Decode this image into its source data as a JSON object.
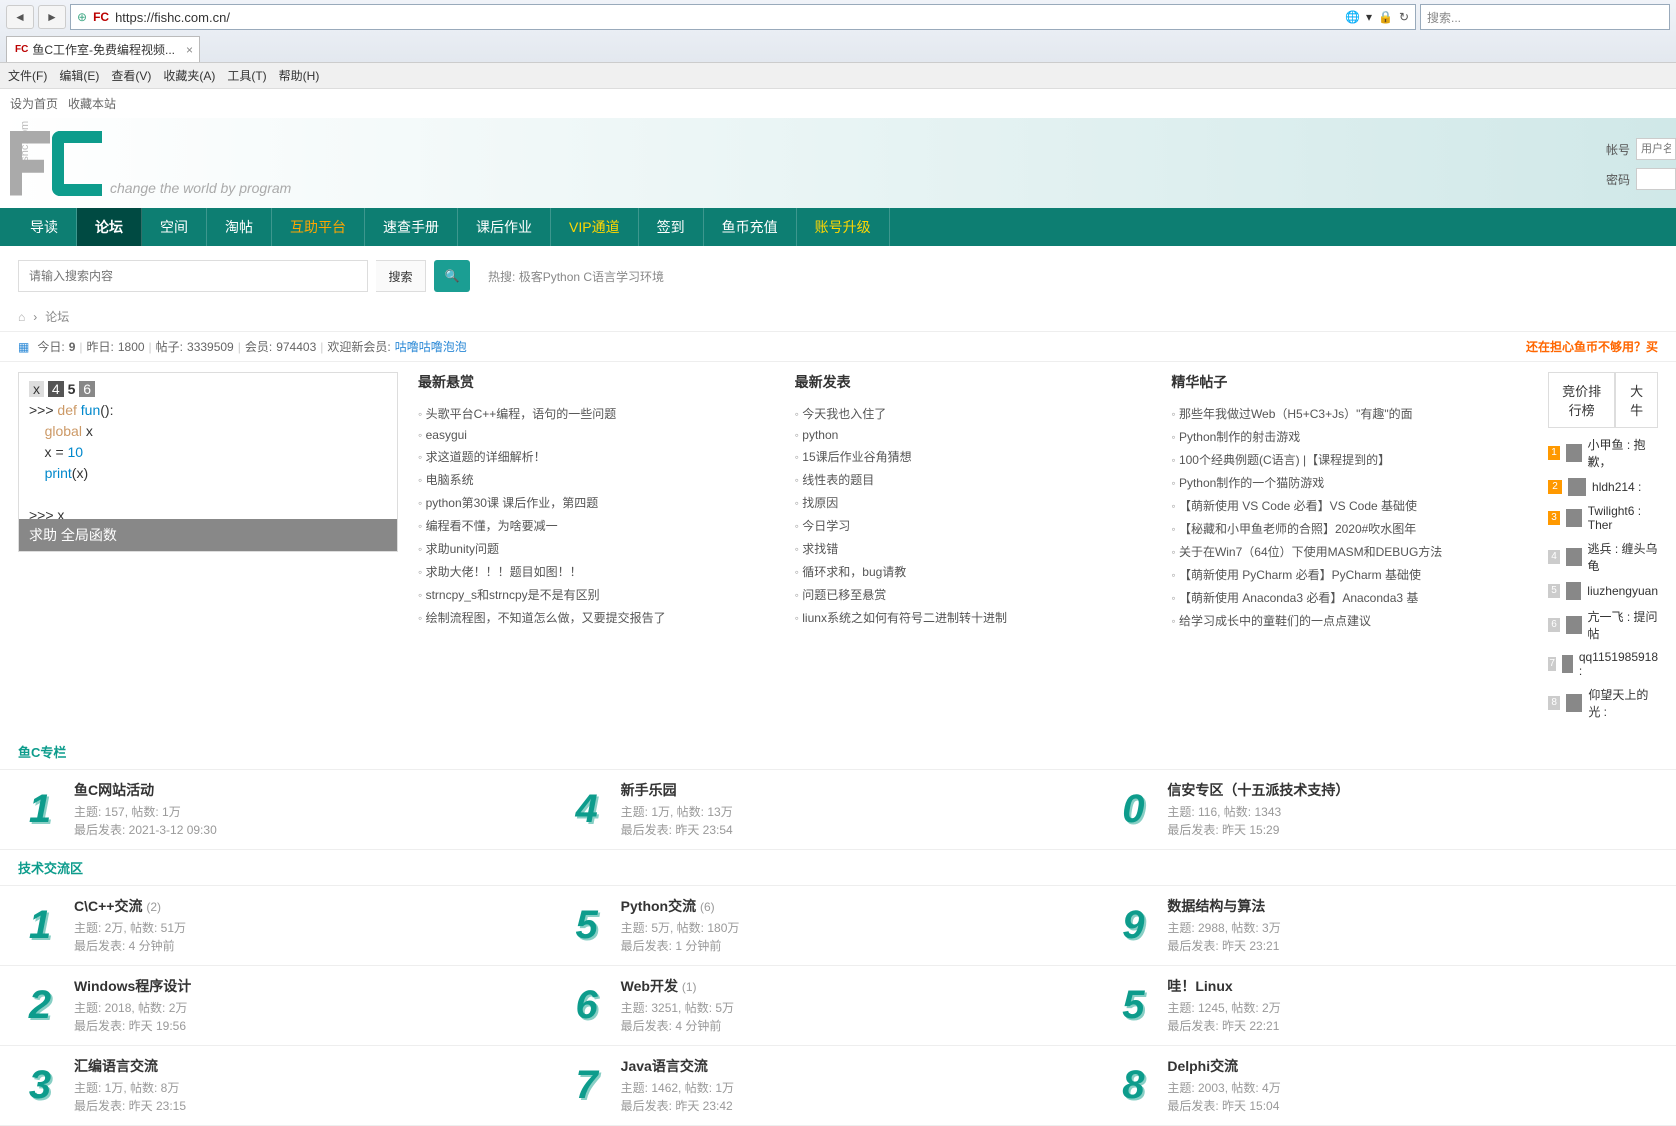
{
  "browser": {
    "url": "https://fishc.com.cn/",
    "search_placeholder": "搜索...",
    "tab_title": "鱼C工作室-免费编程视频...",
    "menus": [
      "文件(F)",
      "编辑(E)",
      "查看(V)",
      "收藏夹(A)",
      "工具(T)",
      "帮助(H)"
    ],
    "sub_links": [
      "设为首页",
      "收藏本站"
    ]
  },
  "logo_tagline": "change the world by program",
  "logo_side": "fishc.com",
  "login": {
    "user_label": "帐号",
    "user_placeholder": "用户名/Email",
    "pass_label": "密码"
  },
  "nav": [
    "导读",
    "论坛",
    "空间",
    "淘帖",
    "互助平台",
    "速查手册",
    "课后作业",
    "VIP通道",
    "签到",
    "鱼币充值",
    "账号升级"
  ],
  "search": {
    "placeholder": "请输入搜索内容",
    "select": "搜索",
    "hot_label": "热搜:",
    "hot_words": "极客Python  C语言学习环境"
  },
  "breadcrumb": "论坛",
  "stats": {
    "today_label": "今日:",
    "today": "9",
    "yesterday_label": "昨日:",
    "yesterday": "1800",
    "posts_label": "帖子:",
    "posts": "3339509",
    "members_label": "会员:",
    "members": "974403",
    "welcome_label": "欢迎新会员:",
    "welcome_name": "咕噜咕噜泡泡",
    "right_text": "还在担心鱼币不够用？买"
  },
  "code_box": {
    "footer": "求助 全局函数"
  },
  "col_titles": {
    "bounty": "最新悬赏",
    "latest": "最新发表",
    "featured": "精华帖子"
  },
  "bounty_list": [
    "头歌平台C++编程，语句的一些问题",
    "easygui",
    "求这道题的详细解析！",
    "电脑系统",
    "python第30课 课后作业，第四题",
    "编程看不懂，为啥要减一",
    "求助unity问题",
    "求助大佬！！！题目如图！！",
    "strncpy_s和strncpy是不是有区别",
    "绘制流程图，不知道怎么做，又要提交报告了"
  ],
  "latest_list": [
    "今天我也入住了",
    "python",
    "15课后作业谷角猜想",
    "线性表的题目",
    "找原因",
    "今日学习",
    "求找错",
    "循环求和，bug请教",
    "问题已移至悬赏",
    "liunx系统之如何有符号二进制转十进制"
  ],
  "featured_list": [
    "那些年我做过Web（H5+C3+Js）\"有趣\"的面",
    "Python制作的射击游戏",
    "100个经典例题(C语言) |【课程提到的】",
    "Python制作的一个猫防游戏",
    "【萌新使用 VS Code 必看】VS Code 基础使",
    "【秘藏和小甲鱼老师的合照】2020#吹水图年",
    "关于在Win7（64位）下使用MASM和DEBUG方法",
    "【萌新使用 PyCharm 必看】PyCharm 基础使",
    "【萌新使用 Anaconda3 必看】Anaconda3 基",
    "给学习成长中的童鞋们的一点点建议"
  ],
  "side_tabs": [
    "竞价排行榜",
    "大牛"
  ],
  "ranking": [
    {
      "n": "1",
      "name": "小甲鱼 : 抱歉，"
    },
    {
      "n": "2",
      "name": "hldh214 :"
    },
    {
      "n": "3",
      "name": "Twilight6 : Ther"
    },
    {
      "n": "4",
      "name": "逃兵 : 缠头乌龟"
    },
    {
      "n": "5",
      "name": "liuzhengyuan"
    },
    {
      "n": "6",
      "name": "亢一飞 : 提问帖"
    },
    {
      "n": "7",
      "name": "qq1151985918 :"
    },
    {
      "n": "8",
      "name": "仰望天上的光 :"
    }
  ],
  "sections": [
    {
      "title": "鱼C专栏",
      "forums": [
        [
          {
            "num": "1",
            "title": "鱼C网站活动",
            "cnt": "",
            "meta1": "主题: 157, 帖数: 1万",
            "meta2": "最后发表: 2021-3-12 09:30"
          },
          {
            "num": "4",
            "title": "新手乐园",
            "cnt": "",
            "meta1": "主题: 1万, 帖数: 13万",
            "meta2": "最后发表: 昨天 23:54"
          },
          {
            "num": "0",
            "title": "信安专区（十五派技术支持）",
            "cnt": "",
            "meta1": "主题: 116, 帖数: 1343",
            "meta2": "最后发表: 昨天 15:29"
          }
        ]
      ]
    },
    {
      "title": "技术交流区",
      "forums": [
        [
          {
            "num": "1",
            "title": "C\\C++交流",
            "cnt": "(2)",
            "meta1": "主题: 2万, 帖数: 51万",
            "meta2": "最后发表: 4 分钟前"
          },
          {
            "num": "5",
            "title": "Python交流",
            "cnt": "(6)",
            "meta1": "主题: 5万, 帖数: 180万",
            "meta2": "最后发表: 1 分钟前"
          },
          {
            "num": "9",
            "title": "数据结构与算法",
            "cnt": "",
            "meta1": "主题: 2988, 帖数: 3万",
            "meta2": "最后发表: 昨天 23:21"
          }
        ],
        [
          {
            "num": "2",
            "title": "Windows程序设计",
            "cnt": "",
            "meta1": "主题: 2018, 帖数: 2万",
            "meta2": "最后发表: 昨天 19:56"
          },
          {
            "num": "6",
            "title": "Web开发",
            "cnt": "(1)",
            "meta1": "主题: 3251, 帖数: 5万",
            "meta2": "最后发表: 4 分钟前"
          },
          {
            "num": "5",
            "title": "哇！Linux",
            "cnt": "",
            "meta1": "主题: 1245, 帖数: 2万",
            "meta2": "最后发表: 昨天 22:21"
          }
        ],
        [
          {
            "num": "3",
            "title": "汇编语言交流",
            "cnt": "",
            "meta1": "主题: 1万, 帖数: 8万",
            "meta2": "最后发表: 昨天 23:15"
          },
          {
            "num": "7",
            "title": "Java语言交流",
            "cnt": "",
            "meta1": "主题: 1462, 帖数: 1万",
            "meta2": "最后发表: 昨天 23:42"
          },
          {
            "num": "8",
            "title": "Delphi交流",
            "cnt": "",
            "meta1": "主题: 2003, 帖数: 4万",
            "meta2": "最后发表: 昨天 15:04"
          }
        ]
      ]
    }
  ]
}
